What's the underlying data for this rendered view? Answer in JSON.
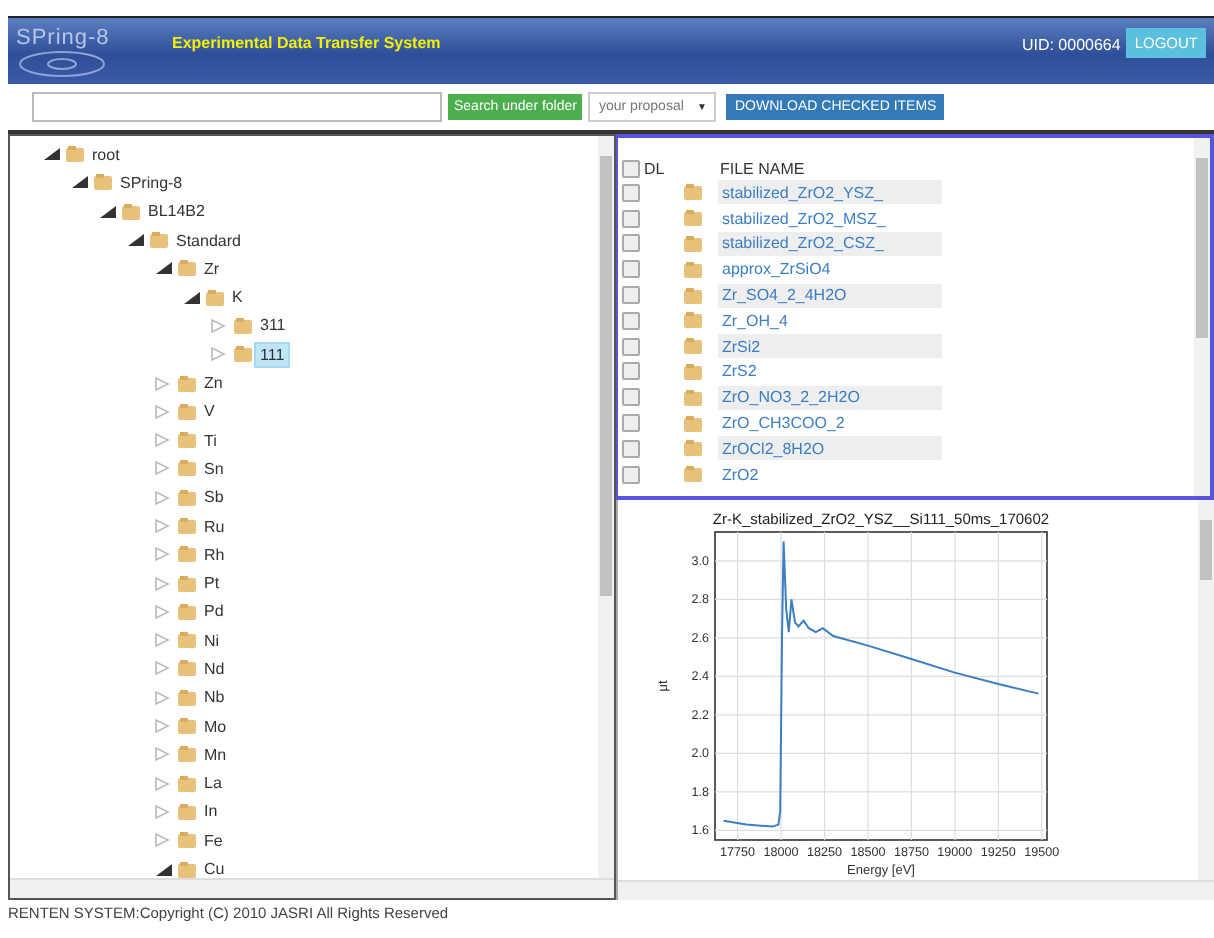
{
  "header": {
    "logo": "SPring-8",
    "title": "Experimental Data Transfer System",
    "uid": "UID: 0000664",
    "logout": "LOGOUT"
  },
  "toolbar": {
    "search_button": "Search under folder",
    "proposal_select": "your proposal",
    "proposal_caret": "▼",
    "download_button": "DOWNLOAD CHECKED ITEMS"
  },
  "tree": [
    {
      "label": "root",
      "expanded": true,
      "selected": false,
      "children": [
        {
          "label": "SPring-8",
          "expanded": true,
          "selected": false,
          "children": [
            {
              "label": "BL14B2",
              "expanded": true,
              "selected": false,
              "children": [
                {
                  "label": "Standard",
                  "expanded": true,
                  "selected": false,
                  "children": [
                    {
                      "label": "Zr",
                      "expanded": true,
                      "selected": false,
                      "children": [
                        {
                          "label": "K",
                          "expanded": true,
                          "selected": false,
                          "children": [
                            {
                              "label": "311",
                              "expanded": false,
                              "selected": false
                            },
                            {
                              "label": "111",
                              "expanded": false,
                              "selected": true
                            }
                          ]
                        }
                      ]
                    },
                    {
                      "label": "Zn",
                      "expanded": false,
                      "selected": false
                    },
                    {
                      "label": "V",
                      "expanded": false,
                      "selected": false
                    },
                    {
                      "label": "Ti",
                      "expanded": false,
                      "selected": false
                    },
                    {
                      "label": "Sn",
                      "expanded": false,
                      "selected": false
                    },
                    {
                      "label": "Sb",
                      "expanded": false,
                      "selected": false
                    },
                    {
                      "label": "Ru",
                      "expanded": false,
                      "selected": false
                    },
                    {
                      "label": "Rh",
                      "expanded": false,
                      "selected": false
                    },
                    {
                      "label": "Pt",
                      "expanded": false,
                      "selected": false
                    },
                    {
                      "label": "Pd",
                      "expanded": false,
                      "selected": false
                    },
                    {
                      "label": "Ni",
                      "expanded": false,
                      "selected": false
                    },
                    {
                      "label": "Nd",
                      "expanded": false,
                      "selected": false
                    },
                    {
                      "label": "Nb",
                      "expanded": false,
                      "selected": false
                    },
                    {
                      "label": "Mo",
                      "expanded": false,
                      "selected": false
                    },
                    {
                      "label": "Mn",
                      "expanded": false,
                      "selected": false
                    },
                    {
                      "label": "La",
                      "expanded": false,
                      "selected": false
                    },
                    {
                      "label": "In",
                      "expanded": false,
                      "selected": false
                    },
                    {
                      "label": "Fe",
                      "expanded": false,
                      "selected": false
                    },
                    {
                      "label": "Cu",
                      "expanded": true,
                      "selected": false
                    }
                  ]
                }
              ]
            }
          ]
        }
      ]
    }
  ],
  "file_list": {
    "columns": [
      "DL",
      "FILE NAME"
    ],
    "all_checked": false,
    "rows": [
      {
        "name": "stabilized_ZrO2_YSZ_",
        "checked": false
      },
      {
        "name": "stabilized_ZrO2_MSZ_",
        "checked": false
      },
      {
        "name": "stabilized_ZrO2_CSZ_",
        "checked": false
      },
      {
        "name": "approx_ZrSiO4",
        "checked": false
      },
      {
        "name": "Zr_SO4_2_4H2O",
        "checked": false
      },
      {
        "name": "Zr_OH_4",
        "checked": false
      },
      {
        "name": "ZrSi2",
        "checked": false
      },
      {
        "name": "ZrS2",
        "checked": false
      },
      {
        "name": "ZrO_NO3_2_2H2O",
        "checked": false
      },
      {
        "name": "ZrO_CH3COO_2",
        "checked": false
      },
      {
        "name": "ZrOCl2_8H2O",
        "checked": false
      },
      {
        "name": "ZrO2",
        "checked": false
      }
    ]
  },
  "plot": {
    "chart_data": {
      "type": "line",
      "title": "Zr-K_stabilized_ZrO2_YSZ__Si111_50ms_170602",
      "xlabel": "Energy [eV]",
      "ylabel": "μt",
      "x": [
        17670,
        17800,
        17950,
        17985,
        17995,
        18005,
        18015,
        18030,
        18045,
        18060,
        18080,
        18100,
        18130,
        18160,
        18200,
        18240,
        18300,
        18500,
        18750,
        19000,
        19250,
        19480
      ],
      "series": [
        {
          "color": "#3b7fc0",
          "values": [
            1.65,
            1.63,
            1.62,
            1.63,
            1.7,
            2.6,
            3.1,
            2.75,
            2.63,
            2.8,
            2.68,
            2.66,
            2.69,
            2.65,
            2.63,
            2.65,
            2.61,
            2.56,
            2.49,
            2.42,
            2.36,
            2.31
          ]
        }
      ],
      "xlim": [
        17620,
        19530
      ],
      "ylim": [
        1.55,
        3.15
      ],
      "grid": true,
      "xticks": [
        17750,
        18000,
        18250,
        18500,
        18750,
        19000,
        19250,
        19500
      ],
      "yticks": [
        1.6,
        1.8,
        {
          "value": 2,
          "label": "2.0"
        },
        2.2,
        2.4,
        2.6,
        2.8,
        {
          "value": 3,
          "label": "3.0"
        }
      ]
    }
  },
  "footer": "RENTEN SYSTEM:Copyright (C) 2010 JASRI All Rights Reserved"
}
